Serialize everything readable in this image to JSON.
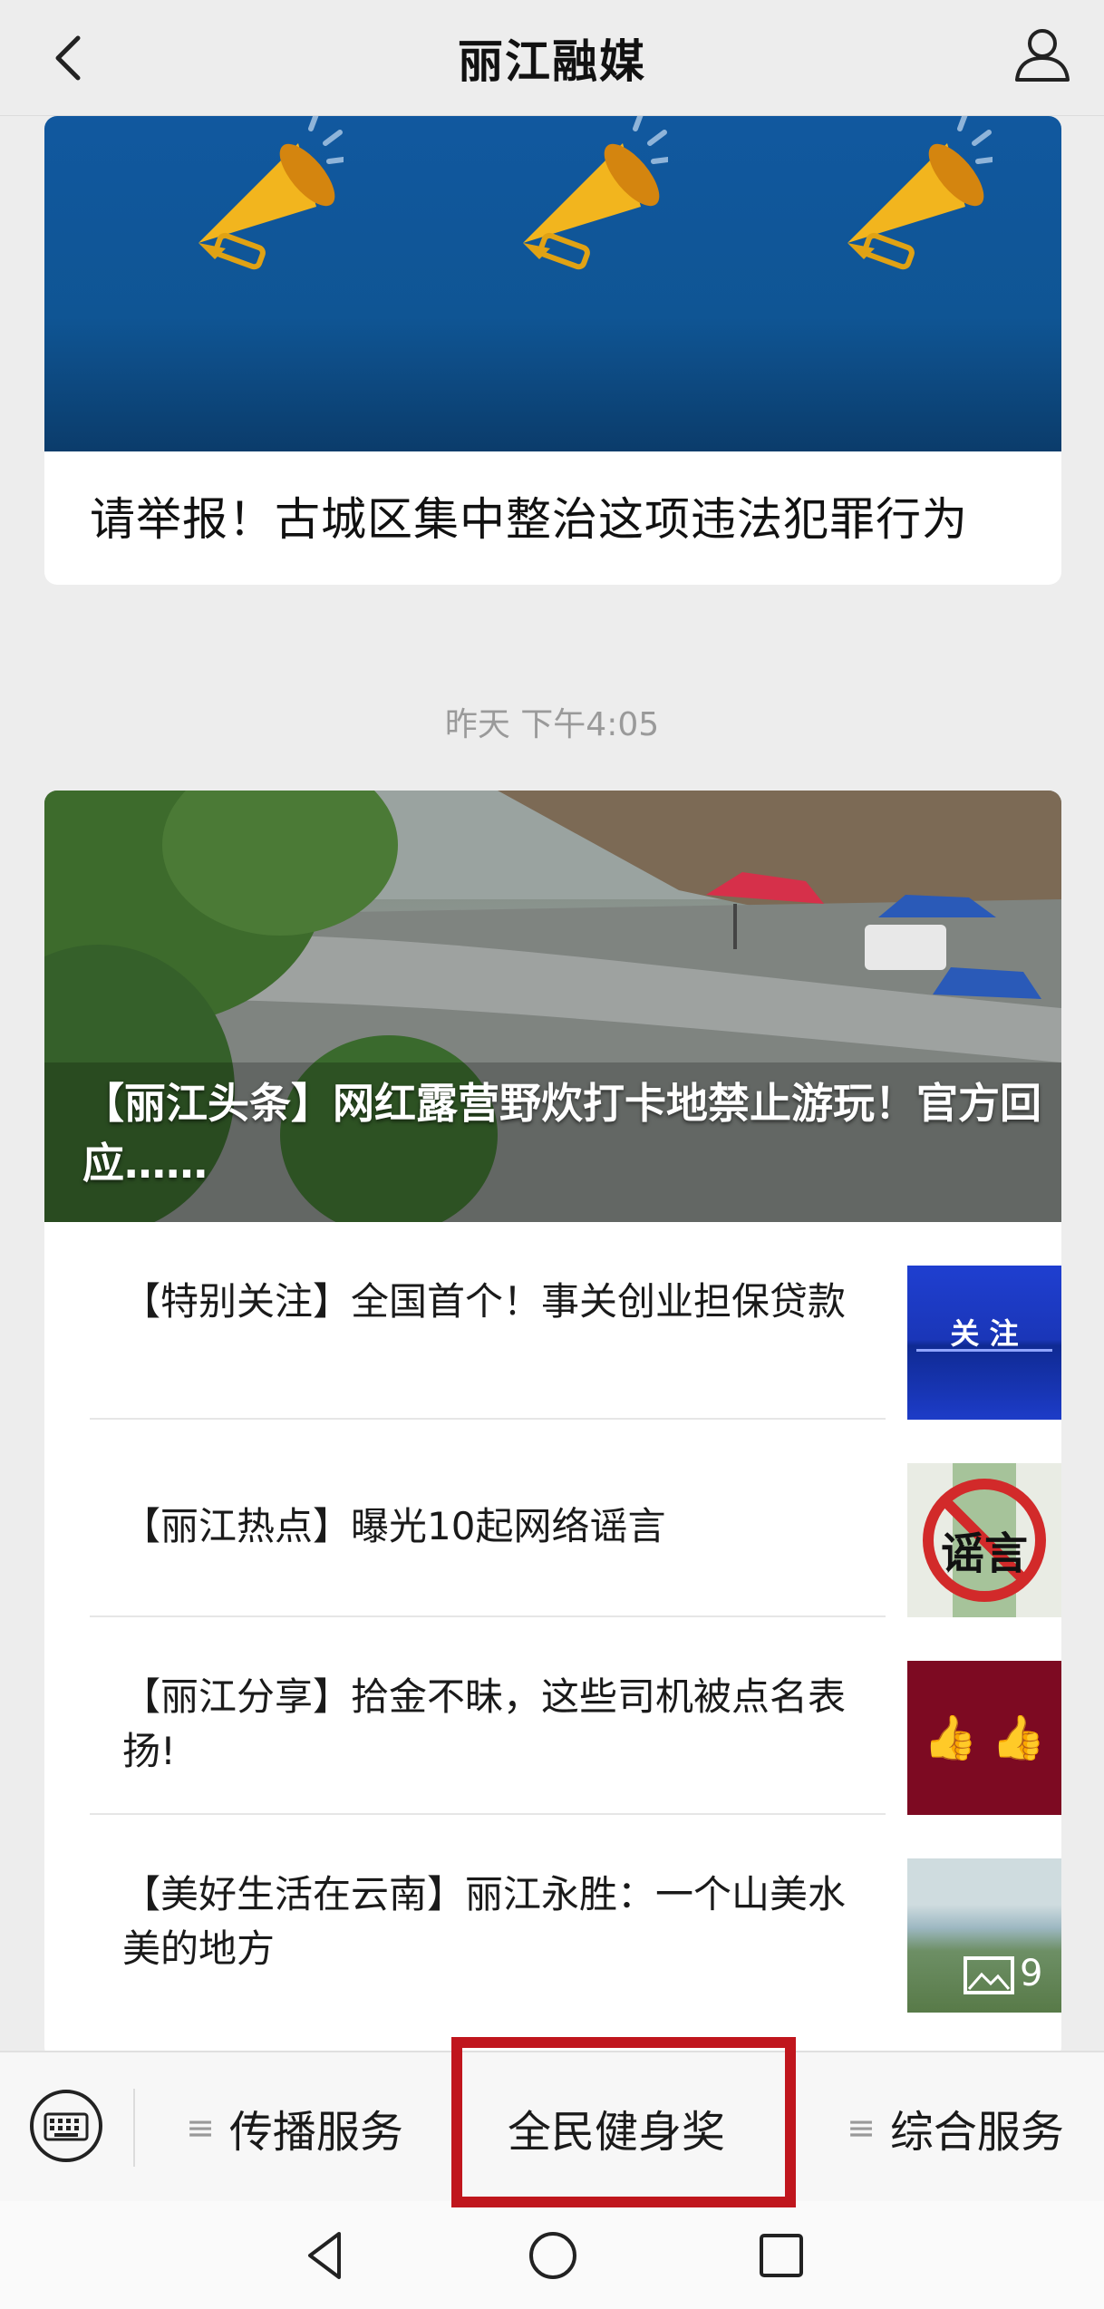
{
  "header": {
    "title": "丽江融媒"
  },
  "card1": {
    "title": "请举报！古城区集中整治这项违法犯罪行为"
  },
  "timestamp": "昨天 下午4:05",
  "card2": {
    "hero_title": "【丽江头条】网红露营野炊打卡地禁止游玩！官方回应……",
    "items": [
      {
        "title": "【特别关注】全国首个！事关创业担保贷款",
        "thumb_text": "关 注"
      },
      {
        "title": "【丽江热点】曝光10起网络谣言",
        "thumb_text": "谣言"
      },
      {
        "title": "【丽江分享】拾金不昧，这些司机被点名表扬!",
        "thumb_text": "👍 👍"
      },
      {
        "title": "【美好生活在云南】丽江永胜：一个山美水美的地方",
        "thumb_count": "9"
      }
    ]
  },
  "menu": [
    {
      "label": "传播服务"
    },
    {
      "label": "全民健身奖"
    },
    {
      "label": "综合服务"
    }
  ],
  "colors": {
    "accent_highlight": "#c0161d",
    "banner_blue": "#11589f"
  }
}
